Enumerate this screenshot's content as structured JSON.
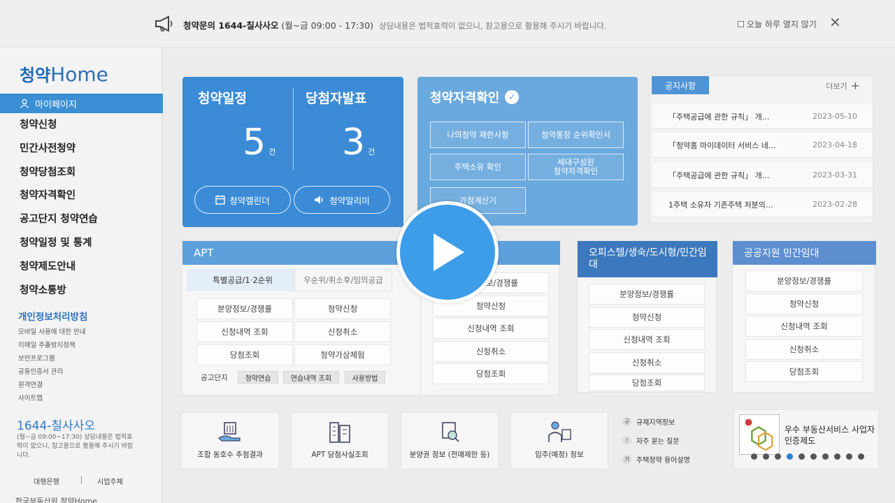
{
  "topbar": {
    "notice_bold": "청약문의 1644-칠사사오",
    "notice_hours": "(월~금 09:00 - 17:30)",
    "notice_sub": "상담내용은 법적효력이 없으니, 참고용으로 활용해 주시기 바랍니다.",
    "today_label": "오늘 하루 열지 않기",
    "close_glyph": "✕"
  },
  "sidebar": {
    "logo_ko": "청약",
    "logo_en": "Home",
    "mypage": "마이페이지",
    "menu": [
      "청약신청",
      "민간사전청약",
      "청약당첨조회",
      "청약자격확인",
      "공고단지 청약연습",
      "청약일정 및 통계",
      "청약제도안내",
      "청약소통방"
    ],
    "privacy": "개인정보처리방침",
    "sublinks": [
      "모바일 사용에 대한 안내",
      "이메일 추출방지정책",
      "보안프로그램",
      "공동인증서 관리",
      "원격연결",
      "사이트맵"
    ],
    "call_number": "1644-칠사사오",
    "call_desc": "(월~금 09:00~17:30) 상담내용은 법적효력이 없으니, 참고용으로 활용해 주시기 바랍니다.",
    "bottom_links": [
      "대행은행",
      "시업주체"
    ],
    "footer_logo": "한국부동산원 청약Home"
  },
  "schedule": {
    "title1": "청약일정",
    "title2": "당첨자발표",
    "count1": "5",
    "count2": "3",
    "unit": "건",
    "btn_calendar": "청약캘린더",
    "btn_alarm": "청약알리미"
  },
  "qualification": {
    "title": "청약자격확인",
    "buttons": [
      "나의청약 제한사항",
      "청약통장 순위확인서",
      "주택소유 확인",
      "세대구성원\n청약자격확인",
      "가점계산기"
    ]
  },
  "notices": {
    "tab": "공지사항",
    "more": "더보기",
    "rows": [
      {
        "title": "「주택공급에 관한 규칙」 개…",
        "date": "2023-05-10"
      },
      {
        "title": "「청약홈 마이데이터 서비스 네…",
        "date": "2023-04-18"
      },
      {
        "title": "「주택공급에 관한 규칙」 개…",
        "date": "2023-03-31"
      },
      {
        "title": "1주택 소유자 기존주택 처분의…",
        "date": "2023-02-28"
      }
    ]
  },
  "apt": {
    "title": "APT",
    "tab_active": "특별공급/1·2순위",
    "tab_other": "우순위/취소후/임의공급",
    "cells": [
      "분양정보/경쟁률",
      "청약신청",
      "신청내역 조회",
      "신청취소",
      "당첨조회",
      "청약가상체험"
    ],
    "chips_label": "공고단지",
    "chips": [
      "청약연습",
      "연습내역 조회",
      "사용방법"
    ],
    "right_cells": [
      "분양정보/경쟁률",
      "청약신청",
      "신청내역 조회",
      "신청취소",
      "당첨조회"
    ]
  },
  "officetel": {
    "title": "오피스텔/생숙/도시형/민간임대",
    "cells": [
      "분양정보/경쟁률",
      "청약신청",
      "신청내역 조회",
      "신청취소",
      "당첨조회"
    ]
  },
  "public": {
    "title": "공공지원 민간임대",
    "cells": [
      "분양정보/경쟁률",
      "청약신청",
      "신청내역 조회",
      "신청취소",
      "당첨조회"
    ]
  },
  "quicklinks": [
    "조합 동호수 추첨결과",
    "APT 당첨사실조회",
    "분양권 정보 (전매제한 등)",
    "입주(예정) 정보"
  ],
  "faq": [
    {
      "icon": "규",
      "label": "규제지역정보"
    },
    {
      "icon": "!",
      "label": "자주 묻는 질문"
    },
    {
      "icon": "가",
      "label": "주택청약 용어설명"
    }
  ],
  "certification": {
    "title_line1": "우수 부동산서비스 사업자",
    "title_line2": "인증제도",
    "dot_count": 10,
    "active_dot": 3
  },
  "colors": {
    "primary": "#3b8bd6",
    "qual": "#6aa9de",
    "apt_head": "#5ea0db",
    "officetel_head": "#3c78bd",
    "public_head": "#5d8fd0",
    "play": "#3d9de8"
  }
}
